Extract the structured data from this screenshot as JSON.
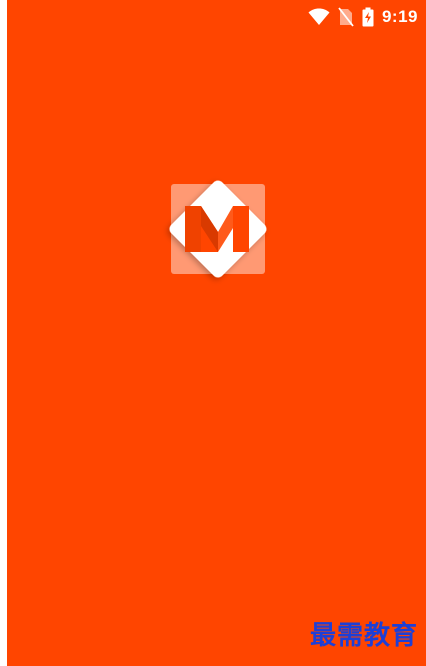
{
  "theme": {
    "background": "#FF4500",
    "status_icon_color": "#FFFFFF",
    "logo_primary": "#FF4500",
    "logo_secondary": "#E13A00",
    "watermark_color": "#1E3FD6"
  },
  "status_bar": {
    "time": "9:19",
    "icons": [
      "wifi-icon",
      "no-sim-icon",
      "battery-charging-icon"
    ]
  },
  "splash": {
    "logo_icon": "m-logo-icon"
  },
  "watermark": {
    "text": "最需教育"
  }
}
